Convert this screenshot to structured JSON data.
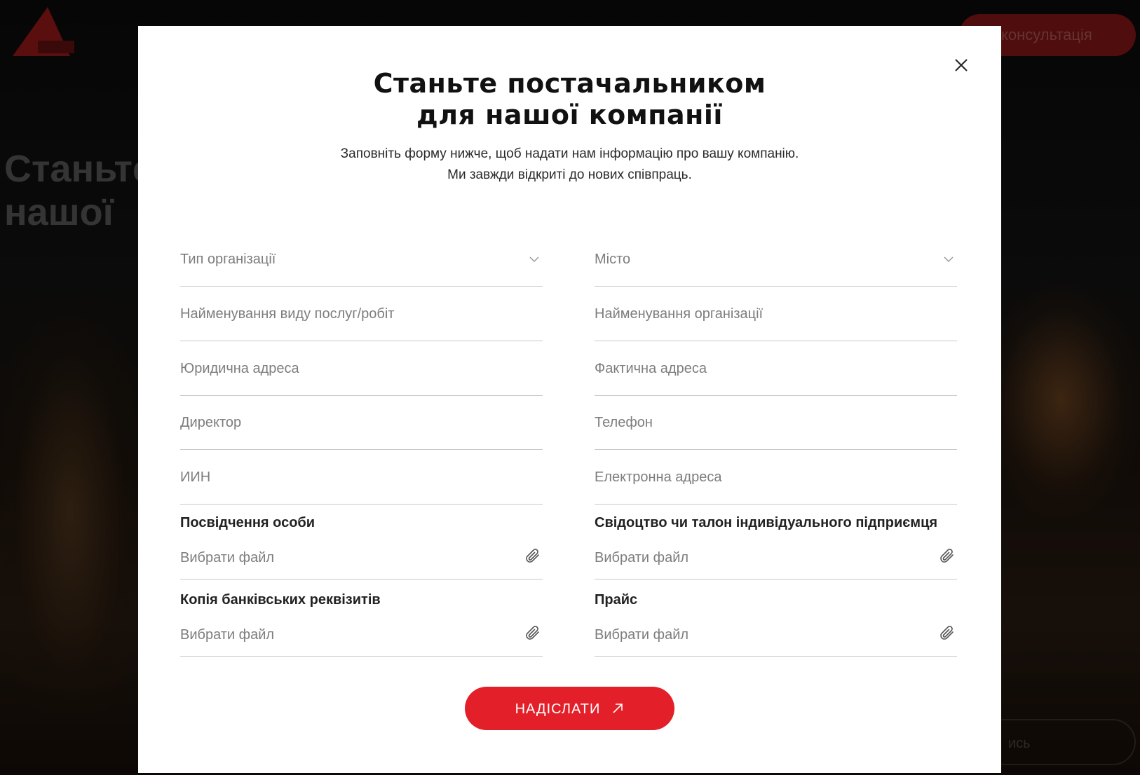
{
  "background": {
    "cta_label": "консультація",
    "hero_title_line1": "Станьте",
    "hero_title_line2": "нашої",
    "side_text": "...",
    "pill_label": "ись"
  },
  "modal": {
    "title_line1": "Станьте постачальником",
    "title_line2": "для нашої компанії",
    "subtitle": "Заповніть форму нижче, щоб надати нам інформацію про вашу компанію. Ми завжди відкриті до нових співпраць.",
    "fields": {
      "org_type": "Тип організації",
      "city": "Місто",
      "service_name": "Найменування виду послуг/робіт",
      "org_name": "Найменування організації",
      "legal_address": "Юридична адреса",
      "actual_address": "Фактична адреса",
      "director": "Директор",
      "phone": "Телефон",
      "iin": "ИИН",
      "email": "Електронна адреса"
    },
    "files": {
      "id_label": "Посвідчення особи",
      "certificate_label": "Свідоцтво чи талон індивідуального підприємця",
      "bank_label": "Копія банківських реквізитів",
      "price_label": "Прайс",
      "choose_file": "Вибрати файл"
    },
    "submit_label": "НАДІСЛАТИ"
  },
  "colors": {
    "accent": "#e3202a",
    "text": "#111111",
    "placeholder": "#7d7d7d",
    "divider": "#c9c9c9"
  }
}
